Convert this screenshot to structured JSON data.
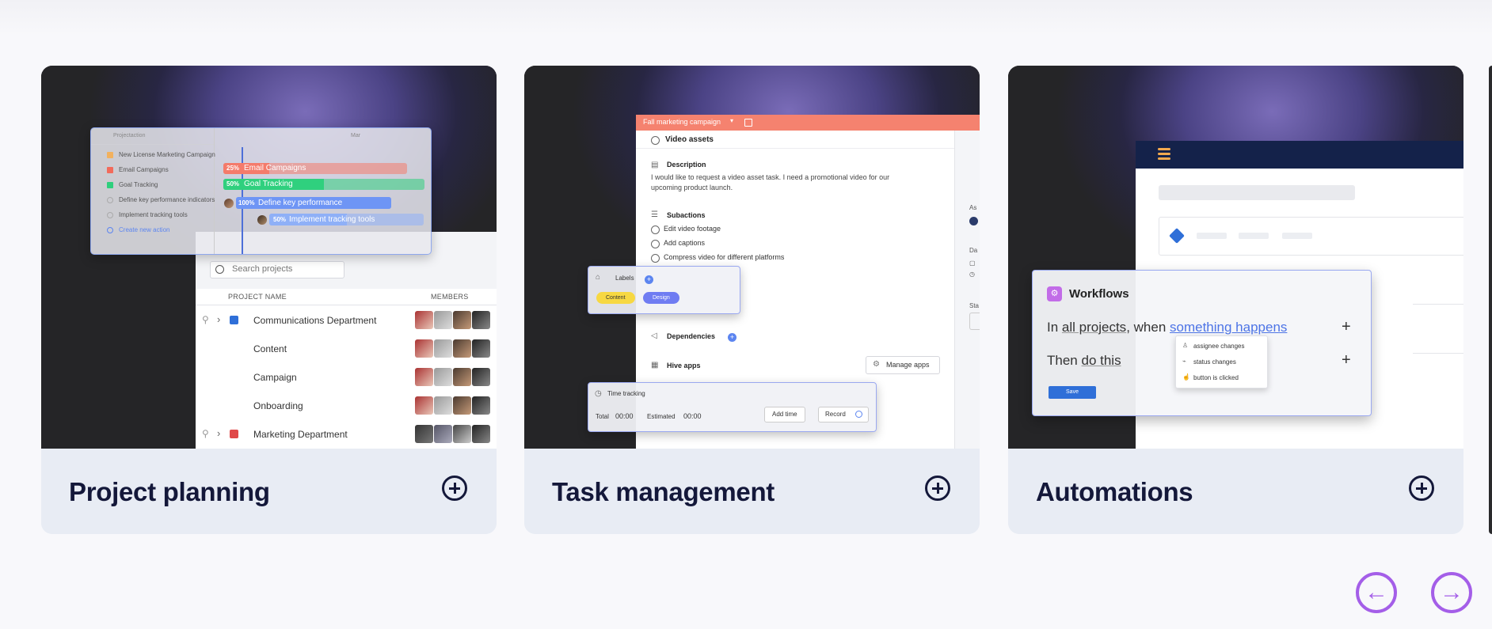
{
  "cards": [
    {
      "title": "Project planning",
      "gantt": {
        "header_label": "Projectaction",
        "month": "Mar",
        "rows": [
          {
            "label": "New License Marketing Campaign",
            "color": "#f2b15e"
          },
          {
            "label": "Email Campaigns",
            "color": "#f26b5b"
          },
          {
            "label": "Goal Tracking",
            "color": "#2fcf7d"
          },
          {
            "label": "Define key performance indicators",
            "color": ""
          },
          {
            "label": "Implement tracking tools",
            "color": ""
          }
        ],
        "create_action": "Create new action",
        "bars": [
          {
            "pct": "25%",
            "label": "Email Campaigns",
            "progress": 0.25,
            "color": "#f47b6b"
          },
          {
            "pct": "50%",
            "label": "Goal Tracking",
            "progress": 0.5,
            "color": "#2fd07e"
          },
          {
            "pct": "100%",
            "label": "Define key performance",
            "progress": 1.0,
            "color": "#6e95f5"
          },
          {
            "pct": "50%",
            "label": "Implement tracking tools",
            "progress": 0.5,
            "color": "#8fb0f7"
          }
        ]
      },
      "projects": {
        "search_placeholder": "Search projects",
        "col_name": "PROJECT NAME",
        "col_members": "MEMBERS",
        "rows": [
          {
            "name": "Communications Department",
            "color": "#2f6fd8"
          },
          {
            "name": "Content",
            "color": ""
          },
          {
            "name": "Campaign",
            "color": ""
          },
          {
            "name": "Onboarding",
            "color": ""
          },
          {
            "name": "Marketing Department",
            "color": "#e04848"
          }
        ]
      }
    },
    {
      "title": "Task management",
      "task": {
        "campaign": "Fall marketing campaign",
        "task_name": "Video assets",
        "description_label": "Description",
        "description": "I would like to request a video asset task. I need a promotional video for our upcoming product launch.",
        "subactions_label": "Subactions",
        "subactions": [
          "Edit video footage",
          "Add captions",
          "Compress video for different platforms"
        ],
        "dependencies_label": "Dependencies",
        "hive_apps_label": "Hive apps",
        "manage_apps": "Manage apps",
        "side_labels": [
          "As",
          "Da",
          "Sta"
        ]
      },
      "labels_popup": {
        "title": "Labels",
        "chips": [
          {
            "text": "Content",
            "color": "#f7d842"
          },
          {
            "text": "Design",
            "color": "#6f7cf2"
          }
        ]
      },
      "time_tracking": {
        "title": "Time tracking",
        "total_label": "Total",
        "total_value": "00:00",
        "estimated_label": "Estimated",
        "estimated_value": "00:00",
        "add_time": "Add time",
        "record": "Record"
      }
    },
    {
      "title": "Automations",
      "workflow": {
        "title": "Workflows",
        "line1_prefix": "In",
        "line1_link1": "all projects",
        "line1_mid": ", when",
        "line1_link2": "something happens",
        "line2_prefix": "Then",
        "line2_link": "do this",
        "save": "Save",
        "menu": [
          "assignee changes",
          "status changes",
          "button is clicked"
        ]
      }
    }
  ],
  "nav": {
    "prev": "←",
    "next": "→"
  }
}
